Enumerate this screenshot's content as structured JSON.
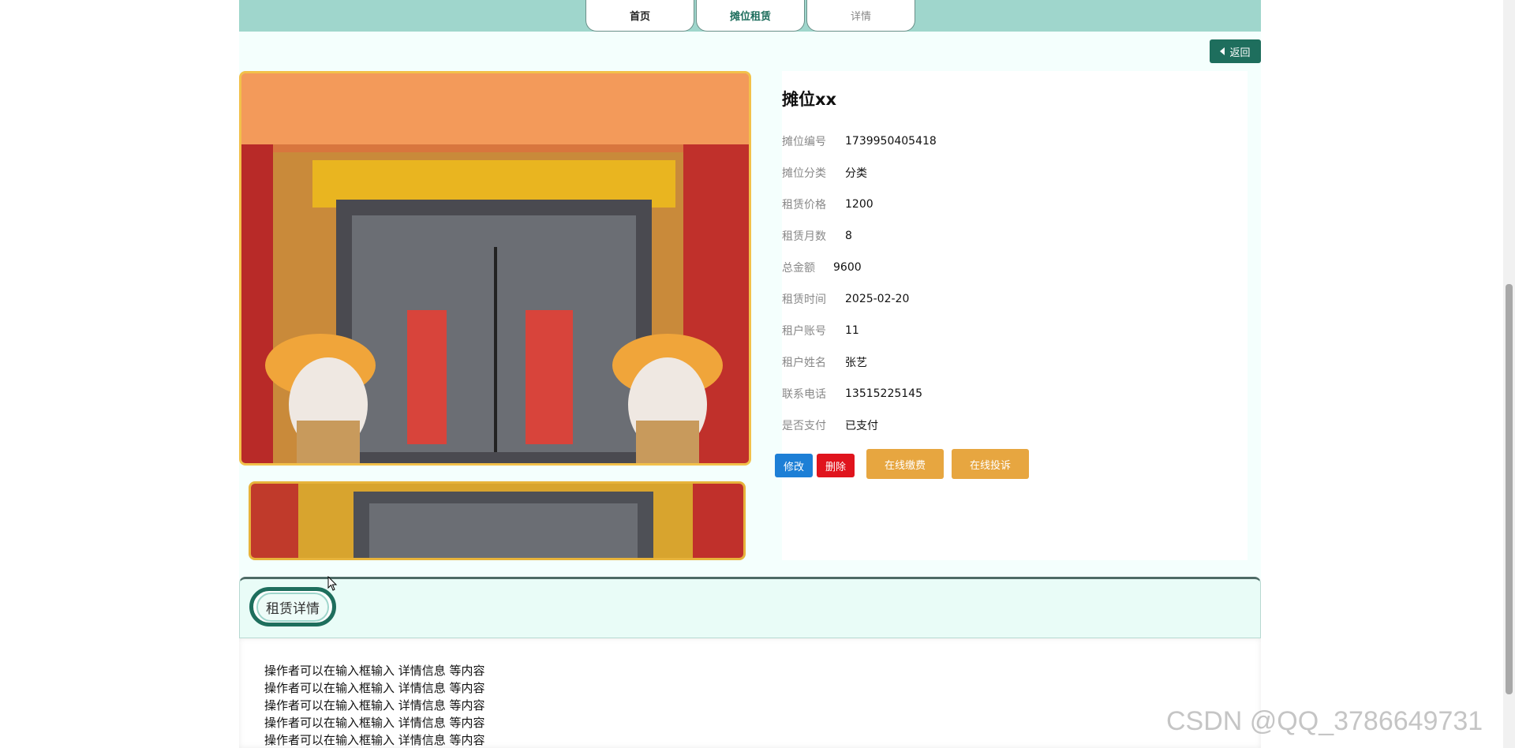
{
  "nav": {
    "tabs": [
      {
        "label": "首页"
      },
      {
        "label": "摊位租赁"
      },
      {
        "label": "详情"
      }
    ]
  },
  "back_button": {
    "label": "返回"
  },
  "detail": {
    "title": "摊位xx",
    "fields": [
      {
        "label": "摊位编号",
        "value": "1739950405418"
      },
      {
        "label": "摊位分类",
        "value": "分类"
      },
      {
        "label": "租赁价格",
        "value": "1200"
      },
      {
        "label": "租赁月数",
        "value": "8"
      },
      {
        "label": "总金额",
        "value": "9600"
      },
      {
        "label": "租赁时间",
        "value": "2025-02-20"
      },
      {
        "label": "租户账号",
        "value": "11"
      },
      {
        "label": "租户姓名",
        "value": "张艺"
      },
      {
        "label": "联系电话",
        "value": "13515225145"
      },
      {
        "label": "是否支付",
        "value": "已支付"
      }
    ],
    "actions": {
      "edit": "修改",
      "delete": "删除",
      "pay": "在线缴费",
      "complain": "在线投诉"
    }
  },
  "rental_details": {
    "heading": "租赁详情",
    "lines": [
      "操作者可以在输入框输入  详情信息  等内容",
      "操作者可以在输入框输入  详情信息  等内容",
      "操作者可以在输入框输入  详情信息  等内容",
      "操作者可以在输入框输入  详情信息  等内容",
      "操作者可以在输入框输入  详情信息  等内容"
    ]
  },
  "watermark": "CSDN @QQ_3786649731",
  "colors": {
    "topbar": "#9fd6cc",
    "primary": "#1e6e5d",
    "edit": "#1d7fd6",
    "delete": "#e0141d",
    "accent": "#e7a640"
  }
}
